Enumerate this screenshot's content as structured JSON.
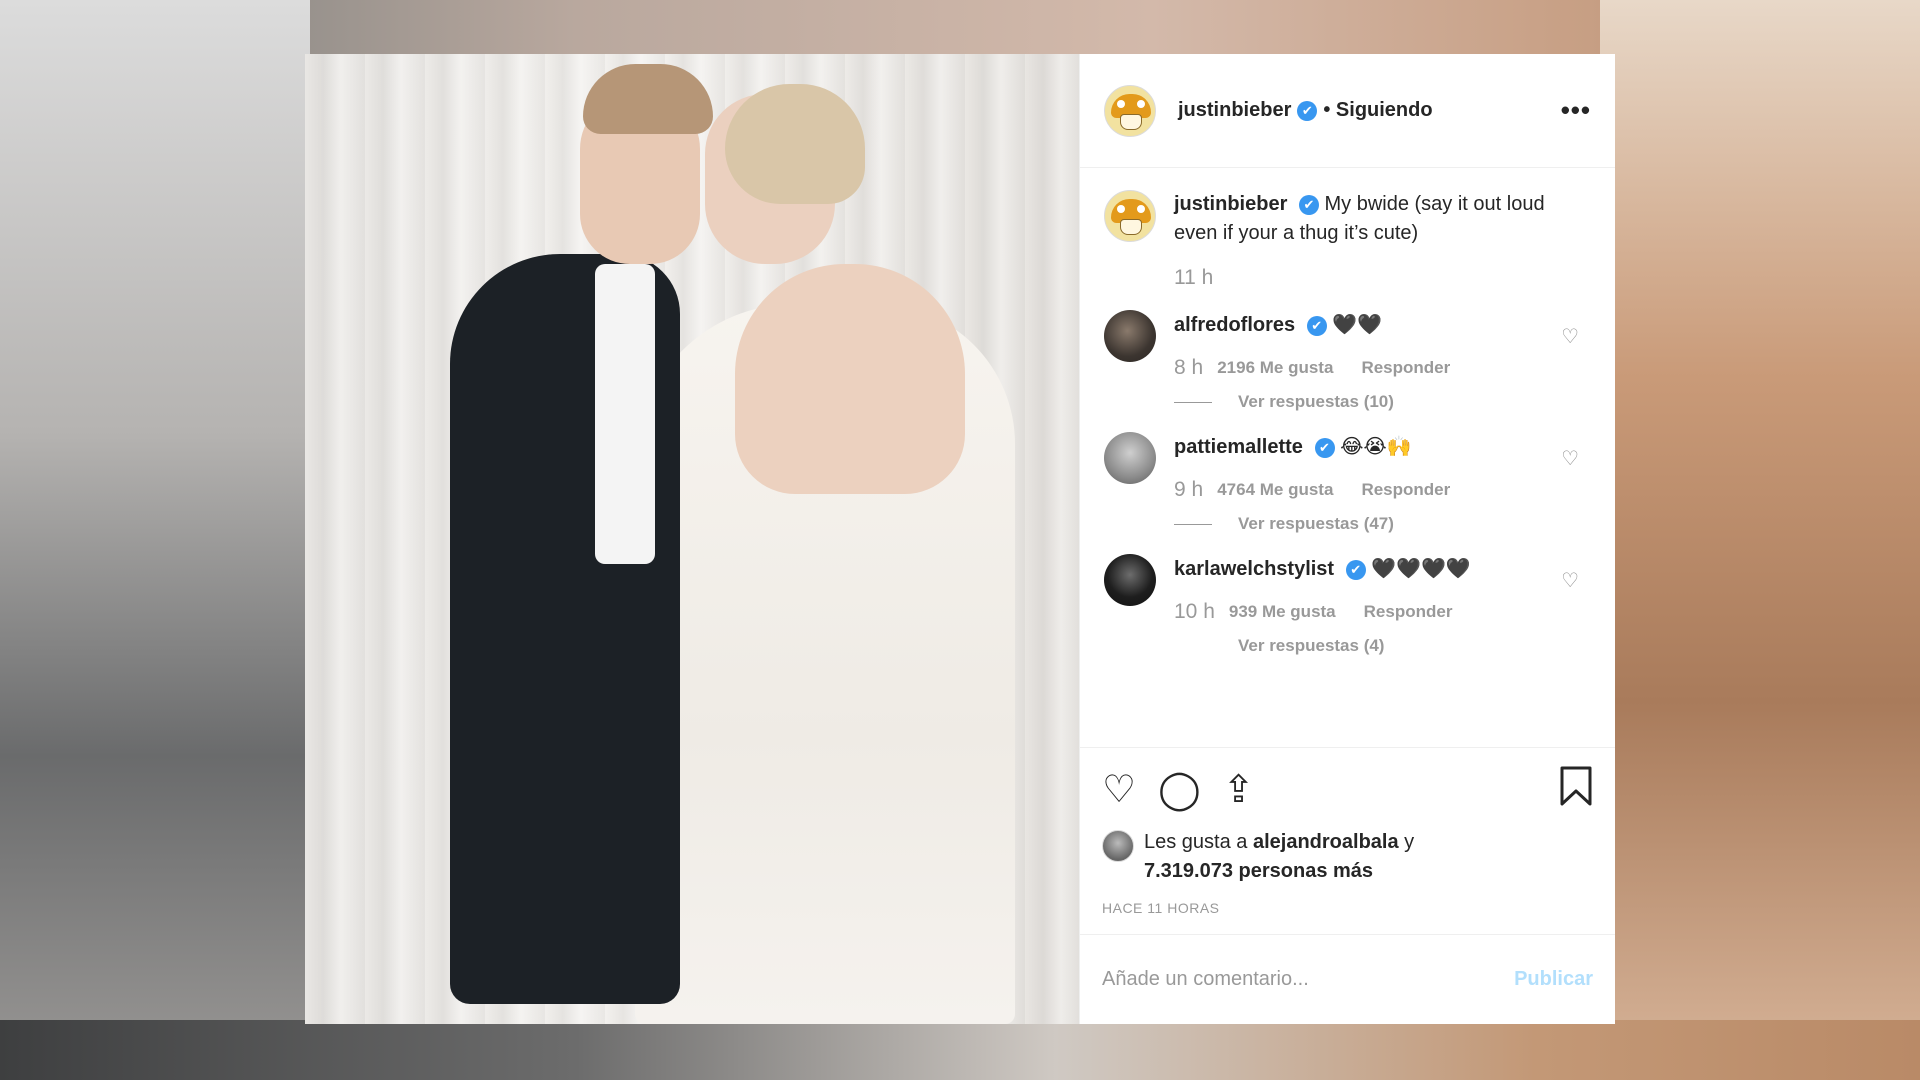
{
  "post": {
    "author": "justinbieber",
    "follow_status": "• Siguiendo",
    "more_icon": "more-horizontal-icon",
    "caption": {
      "user": "justinbieber",
      "text": "My bwide (say it out loud even if your a thug it’s cute)",
      "time": "11 h"
    },
    "comments": [
      {
        "user": "alfredoflores",
        "text": "🖤🖤",
        "time": "8 h",
        "likes": "2196 Me gusta",
        "reply": "Responder",
        "replies": "Ver respuestas (10)"
      },
      {
        "user": "pattiemallette",
        "text": "😂😭🙌",
        "time": "9 h",
        "likes": "4764 Me gusta",
        "reply": "Responder",
        "replies": "Ver respuestas (47)"
      },
      {
        "user": "karlawelchstylist",
        "text": "🖤🖤🖤🖤",
        "time": "10 h",
        "likes": "939 Me gusta",
        "reply": "Responder",
        "replies": "Ver respuestas (4)"
      }
    ],
    "likes": {
      "prefix": "Les gusta a",
      "user": "alejandroalbala",
      "suffix": "y",
      "count": "7.319.073 personas más"
    },
    "timestamp": "HACE 11 HORAS",
    "comment_placeholder": "Añade un comentario...",
    "publish_label": "Publicar",
    "verified_mark": "✔",
    "colors": {
      "verified": "#3897f0",
      "publish": "#b2dffc",
      "text": "#262626",
      "muted": "#999999"
    }
  }
}
